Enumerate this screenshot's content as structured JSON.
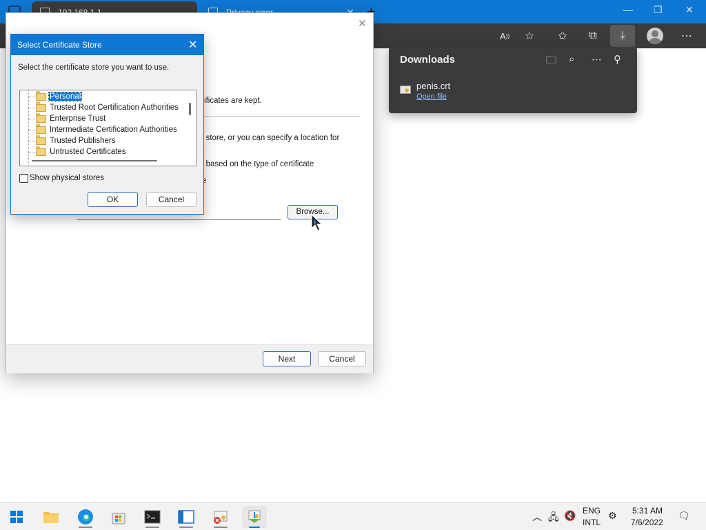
{
  "browser": {
    "tabs": [
      {
        "title": "192.168.1.1"
      },
      {
        "title": "Privacy error"
      }
    ],
    "new_tab": "+"
  },
  "downloads": {
    "title": "Downloads",
    "file": {
      "name": "penis.crt",
      "action": "Open file"
    }
  },
  "wizard": {
    "text_lines": [
      "rtificates are kept.",
      "e store, or you can specify a location for",
      "e based on the type of certificate",
      "re"
    ],
    "browse_label": "Browse...",
    "next_label": "Next",
    "cancel_label": "Cancel"
  },
  "dialog": {
    "title": "Select Certificate Store",
    "prompt": "Select the certificate store you want to use.",
    "stores": [
      {
        "label": "Personal",
        "selected": true
      },
      {
        "label": "Trusted Root Certification Authorities",
        "selected": false
      },
      {
        "label": "Enterprise Trust",
        "selected": false
      },
      {
        "label": "Intermediate Certification Authorities",
        "selected": false
      },
      {
        "label": "Trusted Publishers",
        "selected": false
      },
      {
        "label": "Untrusted Certificates",
        "selected": false
      }
    ],
    "show_physical_label": "Show physical stores",
    "show_physical_checked": false,
    "ok_label": "OK",
    "cancel_label": "Cancel"
  },
  "taskbar": {
    "language": {
      "line1": "ENG",
      "line2": "INTL"
    },
    "time": "5:31 AM",
    "date": "7/6/2022"
  },
  "colors": {
    "accent": "#0e78d4",
    "chrome_dark": "#3b3b3b"
  },
  "icons": {
    "toolbar": [
      "read-aloud-icon",
      "add-favorite-icon",
      "favorites-icon",
      "collections-icon",
      "downloads-icon",
      "profile-icon",
      "more-icon"
    ],
    "tray": [
      "chevron-up-icon",
      "network-icon",
      "volume-muted-icon",
      "settings-icon",
      "notifications-icon"
    ]
  }
}
